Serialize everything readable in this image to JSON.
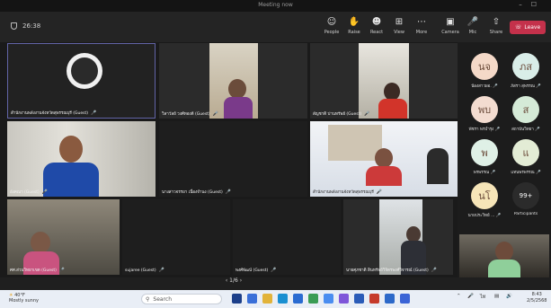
{
  "window": {
    "title": "Meeting now"
  },
  "toolbar": {
    "timer": "26:38",
    "buttons": [
      {
        "label": "People",
        "icon": "people-icon"
      },
      {
        "label": "Raise",
        "icon": "raise-hand-icon"
      },
      {
        "label": "React",
        "icon": "react-icon"
      },
      {
        "label": "View",
        "icon": "view-icon"
      },
      {
        "label": "More",
        "icon": "more-icon"
      },
      {
        "label": "Camera",
        "icon": "camera-icon"
      },
      {
        "label": "Mic",
        "icon": "mic-off-icon"
      },
      {
        "label": "Share",
        "icon": "share-icon"
      }
    ],
    "leave_label": "Leave"
  },
  "tiles": [
    {
      "name": "สำนักงานพลังงานจังหวัดสุพรรณบุรี (Guest)"
    },
    {
      "name": "วิลาวัลย์ วงศ์ทองดี (Guest)"
    },
    {
      "name": "สัญชาติ ปานทรัพย์ (Guest)"
    },
    {
      "name": "อังคณา (Guest)"
    },
    {
      "name": "นางสาวจรรยา เนื่องจำนง (Guest)"
    },
    {
      "name": "สำนักงานพลังงานจังหวัดสุพรรณบุรี"
    },
    {
      "name": "ศศ.ส่วนวิทยาเขต (Guest)"
    },
    {
      "name": "sujaree (Guest)"
    },
    {
      "name": "พงศ์พัฒน์ (Guest)"
    },
    {
      "name": "นายศุภชาติ สินทรัพย์วิจิตรพงศ์วิจารณ์ (Guest)"
    }
  ],
  "participants": [
    {
      "initials": "นจ",
      "name": "น้องสาวผอ.",
      "color": "#f4d9c8"
    },
    {
      "initials": "ภส",
      "name": "ภัสรา สุพรรณ",
      "color": "#d9ede8"
    },
    {
      "initials": "พบ",
      "name": "พัชรา พรบำรุง",
      "color": "#f3dcd0"
    },
    {
      "initials": "ส",
      "name": "สถาบันวิทยา",
      "color": "#d5ead7"
    },
    {
      "initials": "พ",
      "name": "พรพรรณ",
      "color": "#dff0e6"
    },
    {
      "initials": "แ",
      "name": "แทนพรพรรณ",
      "color": "#e3ecd5"
    },
    {
      "initials": "นโ",
      "name": "นายประวิทย์ ...",
      "color": "#f6e5b8"
    },
    {
      "initials": "99+",
      "name": "Participants",
      "color": "#2b2b2b"
    }
  ],
  "pager": {
    "text": "1/6"
  },
  "taskbar": {
    "weather_temp": "40°F",
    "weather_desc": "Mostly sunny",
    "search_placeholder": "Search",
    "time": "8:43",
    "date": "2/5/2568"
  }
}
